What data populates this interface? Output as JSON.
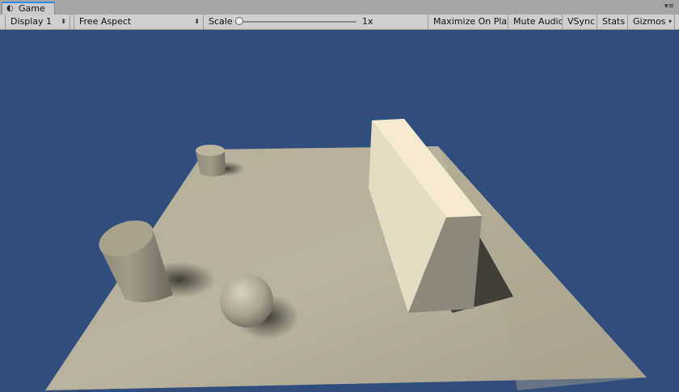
{
  "window": {
    "tab_label": "Game",
    "tab_icon": "unity-game-icon",
    "menu_icon": "▾≡"
  },
  "toolbar": {
    "display": "Display 1",
    "aspect": "Free Aspect",
    "scale_label": "Scale",
    "scale_value": "1x",
    "scale_level": 0.0,
    "maximize_on_play": "Maximize On Play",
    "mute_audio": "Mute Audio",
    "vsync": "VSync",
    "stats": "Stats",
    "gizmos": "Gizmos"
  },
  "viewport": {
    "background_color": "#304d7b",
    "objects": [
      "plane",
      "cube-box",
      "cylinder-small",
      "cylinder-large",
      "sphere"
    ]
  }
}
